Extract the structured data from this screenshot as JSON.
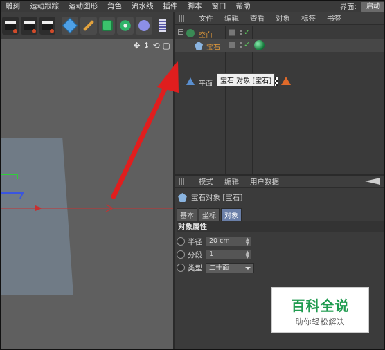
{
  "menubar": {
    "items": [
      "雕刻",
      "运动跟踪",
      "运动图形",
      "角色",
      "流水线",
      "插件",
      "脚本",
      "窗口",
      "帮助"
    ],
    "layout_label": "界面:",
    "layout_value": "启动"
  },
  "object_manager": {
    "menu": [
      "文件",
      "编辑",
      "查看",
      "对象",
      "标签",
      "书签"
    ],
    "objects": [
      {
        "name": "空白",
        "icon": "null-object-icon",
        "color": "#e39a3a",
        "indent": 0
      },
      {
        "name": "宝石",
        "icon": "gem-object-icon",
        "color": "#e39a3a",
        "indent": 1
      },
      {
        "name": "平面",
        "icon": "plane-object-icon",
        "color": "#cfcfcf",
        "indent": 0
      }
    ],
    "tooltip": "宝石 对象 [宝石]"
  },
  "attribute_manager": {
    "menu": [
      "模式",
      "编辑",
      "用户数据"
    ],
    "title": "宝石对象 [宝石]",
    "tabs": [
      "基本",
      "坐标",
      "对象"
    ],
    "active_tab": "对象",
    "section": "对象属性",
    "fields": [
      {
        "label": "半径",
        "value": "20 cm",
        "type": "number"
      },
      {
        "label": "分段",
        "value": "1",
        "type": "number"
      },
      {
        "label": "类型",
        "value": "二十面",
        "type": "dropdown"
      }
    ]
  },
  "watermark": {
    "main": "百科全说",
    "sub": "助你轻松解决"
  },
  "colors": {
    "accent_orange": "#e39a3a",
    "arrow_red": "#e01e1e",
    "tab_active": "#6a7fa8",
    "watermark_green": "#1f9b4f"
  }
}
